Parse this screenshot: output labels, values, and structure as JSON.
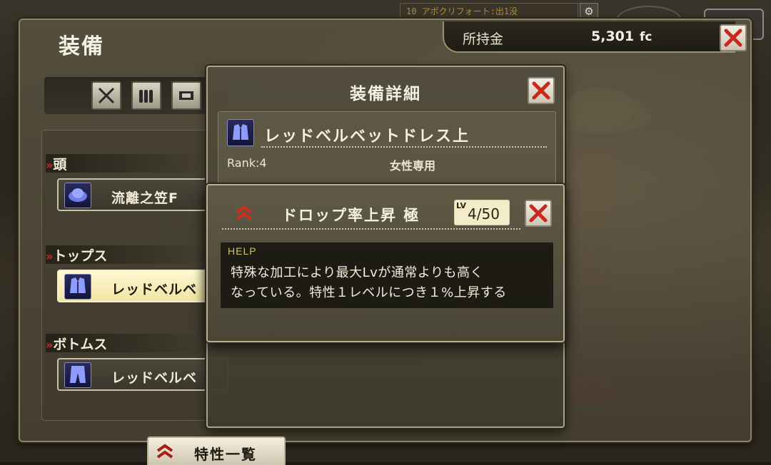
{
  "hud": {
    "quest_text": "10 アポクリフォート:出1没",
    "settings_icon": "gear-icon"
  },
  "window": {
    "title": "装備",
    "money_label": "所持金",
    "money_value": "5,301",
    "money_unit": "fc",
    "close_icon": "close-icon"
  },
  "filters": [
    {
      "icon": "sword-icon"
    },
    {
      "icon": "bullets-icon"
    },
    {
      "icon": "armor-plate-icon"
    }
  ],
  "slots": [
    {
      "label": "頭",
      "item": "流離之笠F",
      "icon": "hat-icon",
      "selected": false
    },
    {
      "label": "トップス",
      "item": "レッドベルベ",
      "icon": "top-icon",
      "selected": true
    },
    {
      "label": "ボトムス",
      "item": "レッドベルベ",
      "icon": "pants-icon",
      "selected": false
    }
  ],
  "detail": {
    "title": "装備詳細",
    "item_name": "レッドベルベットドレス上",
    "rank": "Rank:4",
    "restriction": "女性専用"
  },
  "trait": {
    "name": "ドロップ率上昇 極",
    "lv_prefix": "LV",
    "lv_value": "4/50",
    "help_label": "HELP",
    "help_line1": "特殊な加工により最大Lvが通常よりも高く",
    "help_line2": "なっている。特性１レベルにつき１%上昇する"
  },
  "bottom_tab": {
    "label": "特性一覧"
  },
  "colors": {
    "accent_red": "#d52a1e",
    "selected_bg": "#fff8d2",
    "help_label": "#d6c266"
  }
}
